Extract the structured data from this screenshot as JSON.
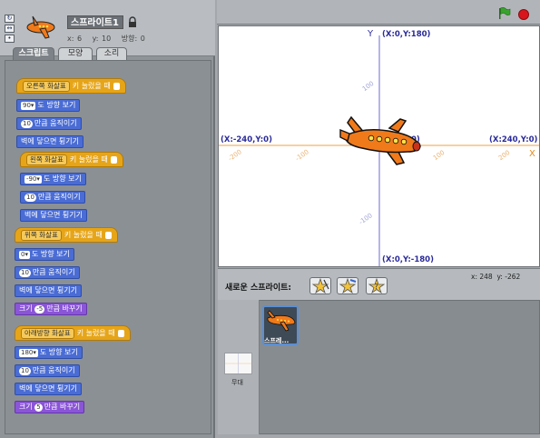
{
  "sprite": {
    "name": "스프라이트1",
    "x_label": "x: 6",
    "y_label": "y: 10",
    "direction_label": "방향: 0"
  },
  "tabs": [
    "스크립트",
    "모양",
    "소리"
  ],
  "scripts": [
    {
      "hat_key": "오른쪽 화살표",
      "hat_text": "키 눌렀을 때",
      "blocks": [
        {
          "kind": "motion",
          "num": "90▾",
          "text": "도 방향 보기"
        },
        {
          "kind": "motion",
          "num": "10",
          "text": "만큼 움직이기"
        },
        {
          "kind": "motion",
          "num": "",
          "text": "벽에 닿으면 튕기기"
        }
      ]
    },
    {
      "hat_key": "왼쪽 화살표",
      "hat_text": "키 눌렀을 때",
      "blocks": [
        {
          "kind": "motion",
          "num": "-90▾",
          "text": "도 방향 보기"
        },
        {
          "kind": "motion",
          "num": "10",
          "text": "만큼 움직이기"
        },
        {
          "kind": "motion",
          "num": "",
          "text": "벽에 닿으면 튕기기"
        }
      ]
    },
    {
      "hat_key": "위쪽 화살표",
      "hat_text": "키 눌렀을 때",
      "blocks": [
        {
          "kind": "motion",
          "num": "0▾",
          "text": "도 방향 보기"
        },
        {
          "kind": "motion",
          "num": "10",
          "text": "만큼 움직이기"
        },
        {
          "kind": "motion",
          "num": "",
          "text": "벽에 닿으면 튕기기"
        },
        {
          "kind": "looks",
          "prefix": "크기",
          "num": "-5",
          "text": "만큼 바꾸기"
        }
      ]
    },
    {
      "hat_key": "아래방향 화살표",
      "hat_text": "키 눌렀을 때",
      "blocks": [
        {
          "kind": "motion",
          "num": "180▾",
          "text": "도 방향 보기"
        },
        {
          "kind": "motion",
          "num": "10",
          "text": "만큼 움직이기"
        },
        {
          "kind": "motion",
          "num": "",
          "text": "벽에 닿으면 튕기기"
        },
        {
          "kind": "looks",
          "prefix": "크기",
          "num": "5",
          "text": "만큼 바꾸기"
        }
      ]
    }
  ],
  "stage": {
    "top_coord": "(X:0,Y:180)",
    "bottom_coord": "(X:0,Y:-180)",
    "left_coord": "(X:-240,Y:0)",
    "right_coord": "(X:240,Y:0)",
    "center_label": "0)",
    "y_letter": "Y",
    "x_letter": "X",
    "ticks_x": [
      "-200",
      "-100",
      "100",
      "200"
    ],
    "ticks_y": [
      "100",
      "-100"
    ]
  },
  "mouse": {
    "x": "x: 248",
    "y": "y: -262"
  },
  "sprite_library": {
    "new_sprite_label": "새로운 스프라이트:",
    "stage_label": "무대",
    "sprite_card_label": "스프레..."
  },
  "colors": {
    "hat": "#e6a519",
    "motion": "#4a6cd4",
    "looks": "#8a55d7",
    "plane": "#f07a1a",
    "stop": "#d8171c",
    "flag": "#3aa32f"
  }
}
